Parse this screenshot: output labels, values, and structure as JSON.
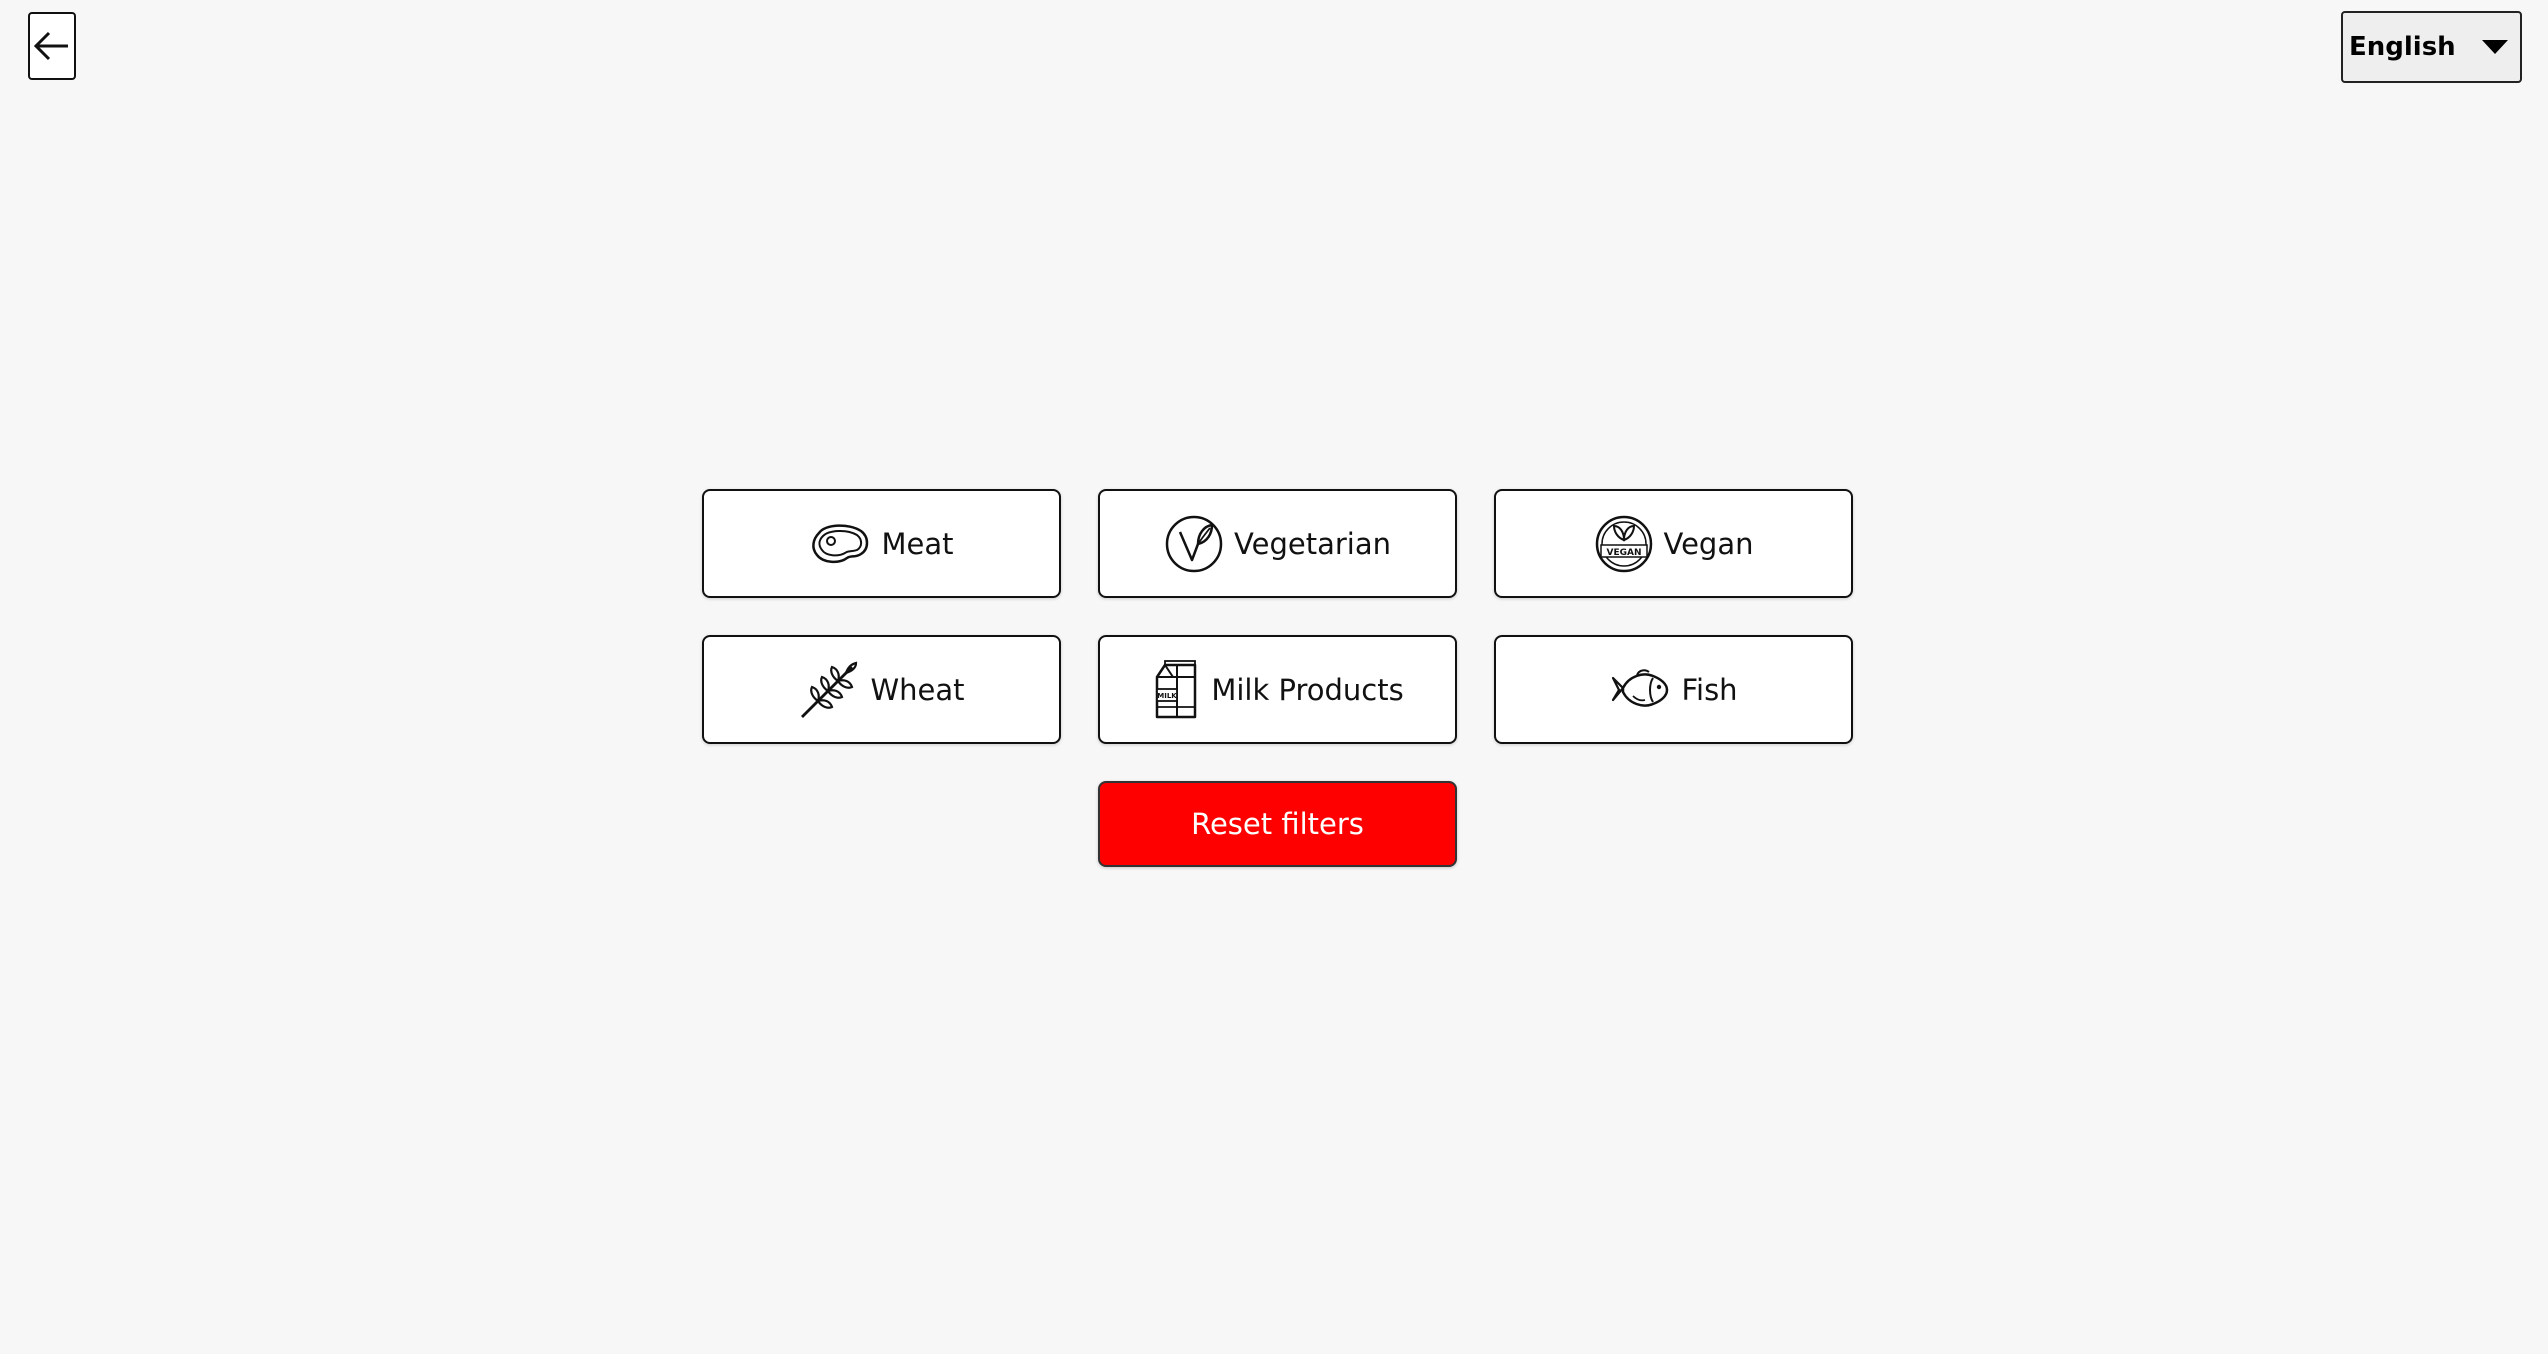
{
  "header": {
    "back_icon": "arrow-left-icon",
    "language": {
      "selected": "English",
      "icon": "caret-down-icon"
    }
  },
  "filters": [
    {
      "label": "Meat",
      "icon": "steak-icon"
    },
    {
      "label": "Vegetarian",
      "icon": "vegetarian-leaf-icon"
    },
    {
      "label": "Vegan",
      "icon": "vegan-badge-icon"
    },
    {
      "label": "Wheat",
      "icon": "wheat-icon"
    },
    {
      "label": "Milk Products",
      "icon": "milk-carton-icon"
    },
    {
      "label": "Fish",
      "icon": "fish-icon"
    }
  ],
  "reset": {
    "label": "Reset filters",
    "color": "#ff0000"
  },
  "colors": {
    "background": "#f7f7f7",
    "button_border": "#111111",
    "reset": "#ff0000"
  }
}
